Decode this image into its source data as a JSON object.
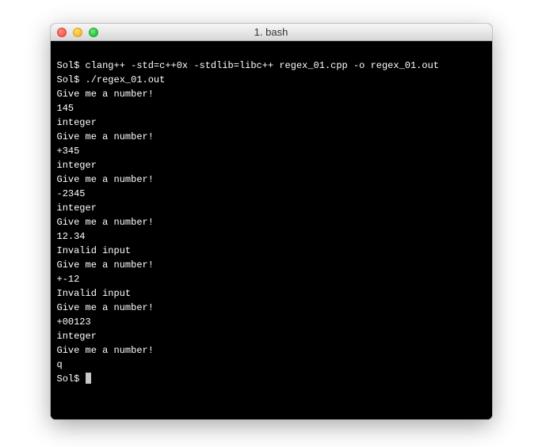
{
  "window": {
    "title": "1. bash"
  },
  "terminal": {
    "prompt": "Sol$ ",
    "lines": [
      "Sol$ clang++ -std=c++0x -stdlib=libc++ regex_01.cpp -o regex_01.out",
      "Sol$ ./regex_01.out",
      "Give me a number!",
      "145",
      "integer",
      "Give me a number!",
      "+345",
      "integer",
      "Give me a number!",
      "-2345",
      "integer",
      "Give me a number!",
      "12.34",
      "Invalid input",
      "Give me a number!",
      "+-12",
      "Invalid input",
      "Give me a number!",
      "+00123",
      "integer",
      "Give me a number!",
      "q",
      "Sol$ "
    ]
  }
}
